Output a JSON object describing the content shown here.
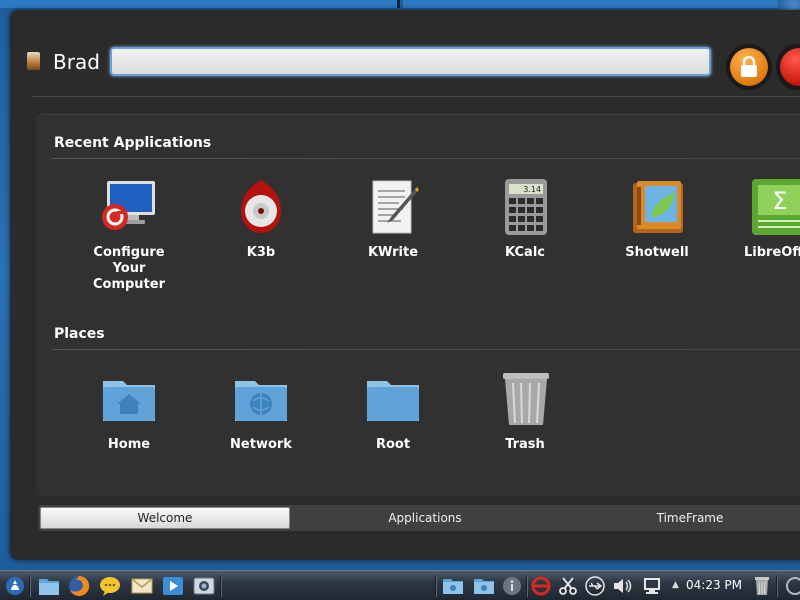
{
  "user": {
    "name": "Brad"
  },
  "search": {
    "value": "",
    "placeholder": ""
  },
  "sections": {
    "recent": {
      "title": "Recent Applications",
      "items": [
        {
          "label": "Configure Your Computer",
          "icon": "system-settings-icon"
        },
        {
          "label": "K3b",
          "icon": "k3b-disc-icon"
        },
        {
          "label": "KWrite",
          "icon": "kwrite-document-icon"
        },
        {
          "label": "KCalc",
          "icon": "calculator-icon"
        },
        {
          "label": "Shotwell",
          "icon": "shotwell-photo-icon"
        },
        {
          "label": "LibreOffice Calc",
          "icon": "libreoffice-calc-icon"
        }
      ]
    },
    "places": {
      "title": "Places",
      "items": [
        {
          "label": "Home",
          "icon": "home-folder-icon"
        },
        {
          "label": "Network",
          "icon": "network-folder-icon"
        },
        {
          "label": "Root",
          "icon": "root-folder-icon"
        },
        {
          "label": "Trash",
          "icon": "trash-icon"
        }
      ]
    }
  },
  "tabs": [
    {
      "label": "Welcome",
      "active": true
    },
    {
      "label": "Applications",
      "active": false
    },
    {
      "label": "TimeFrame",
      "active": false
    }
  ],
  "taskbar": {
    "launchers": [
      "kde-start-icon",
      "file-manager-icon",
      "firefox-icon",
      "chat-icon",
      "mail-icon",
      "media-player-icon",
      "screenshot-icon"
    ],
    "tray": [
      "folder-icon",
      "folder-icon",
      "info-icon",
      "network-sync-icon",
      "clipboard-icon",
      "usb-icon",
      "volume-icon",
      "network-icon"
    ],
    "clock": "04:23 PM"
  },
  "colors": {
    "accent": "#2a71b5",
    "panel": "#2b2b2b",
    "lock": "#e07b12",
    "leave": "#c8150a"
  }
}
